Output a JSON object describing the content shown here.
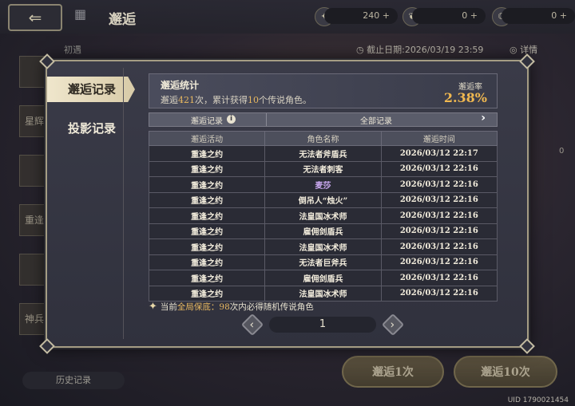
{
  "background": {
    "screen_title": "邂逅",
    "resources": [
      {
        "icon": "compass-icon",
        "value": "240"
      },
      {
        "icon": "feather-icon",
        "value": "0"
      },
      {
        "icon": "moon-icon",
        "value": "0"
      }
    ],
    "subtitle_left": "初遇",
    "deadline": "截止日期:2026/03/19 23:59",
    "details": "详情",
    "left_cards": [
      "",
      "星辉",
      "",
      "重逢",
      "",
      "神兵"
    ],
    "history_button": "历史记录",
    "pull_one": "邂逅1次",
    "pull_ten": "邂逅10次",
    "side_zero": "0",
    "uid": "UID 1790021454"
  },
  "modal": {
    "tabs": [
      {
        "label": "邂逅记录",
        "active": true
      },
      {
        "label": "投影记录",
        "active": false
      }
    ],
    "stats": {
      "title": "邂逅统计",
      "line_prefix": "邂逅",
      "pull_count": "421",
      "line_mid": "次，累计获得",
      "legend_count": "10",
      "line_suffix": "个传说角色。",
      "rate_label": "邂逅率",
      "rate_value": "2.38%"
    },
    "filter": {
      "label": "邂逅记录",
      "value": "全部记录"
    },
    "table": {
      "headers": [
        "邂逅活动",
        "角色名称",
        "邂逅时间"
      ],
      "rows": [
        {
          "event": "重逢之约",
          "name": "无法者斧盾兵",
          "time": "2026/03/12 22:17",
          "rarity": "normal"
        },
        {
          "event": "重逢之约",
          "name": "无法者刺客",
          "time": "2026/03/12 22:16",
          "rarity": "normal"
        },
        {
          "event": "重逢之约",
          "name": "麦莎",
          "time": "2026/03/12 22:16",
          "rarity": "epic"
        },
        {
          "event": "重逢之约",
          "name": "倒吊人“烛火”",
          "time": "2026/03/12 22:16",
          "rarity": "normal"
        },
        {
          "event": "重逢之约",
          "name": "法皇国冰术师",
          "time": "2026/03/12 22:16",
          "rarity": "normal"
        },
        {
          "event": "重逢之约",
          "name": "雇佣剑盾兵",
          "time": "2026/03/12 22:16",
          "rarity": "normal"
        },
        {
          "event": "重逢之约",
          "name": "法皇国冰术师",
          "time": "2026/03/12 22:16",
          "rarity": "normal"
        },
        {
          "event": "重逢之约",
          "name": "无法者巨斧兵",
          "time": "2026/03/12 22:16",
          "rarity": "normal"
        },
        {
          "event": "重逢之约",
          "name": "雇佣剑盾兵",
          "time": "2026/03/12 22:16",
          "rarity": "normal"
        },
        {
          "event": "重逢之约",
          "name": "法皇国冰术师",
          "time": "2026/03/12 22:16",
          "rarity": "normal"
        }
      ]
    },
    "note": {
      "prefix": "当前",
      "highlight": "全局保底：",
      "count": "98",
      "suffix": "次内必得随机传说角色"
    },
    "pager": {
      "page": "1"
    },
    "colors": {
      "accent": "#e8b860",
      "epic": "#c9a8f0",
      "panel": "#30313d"
    }
  }
}
